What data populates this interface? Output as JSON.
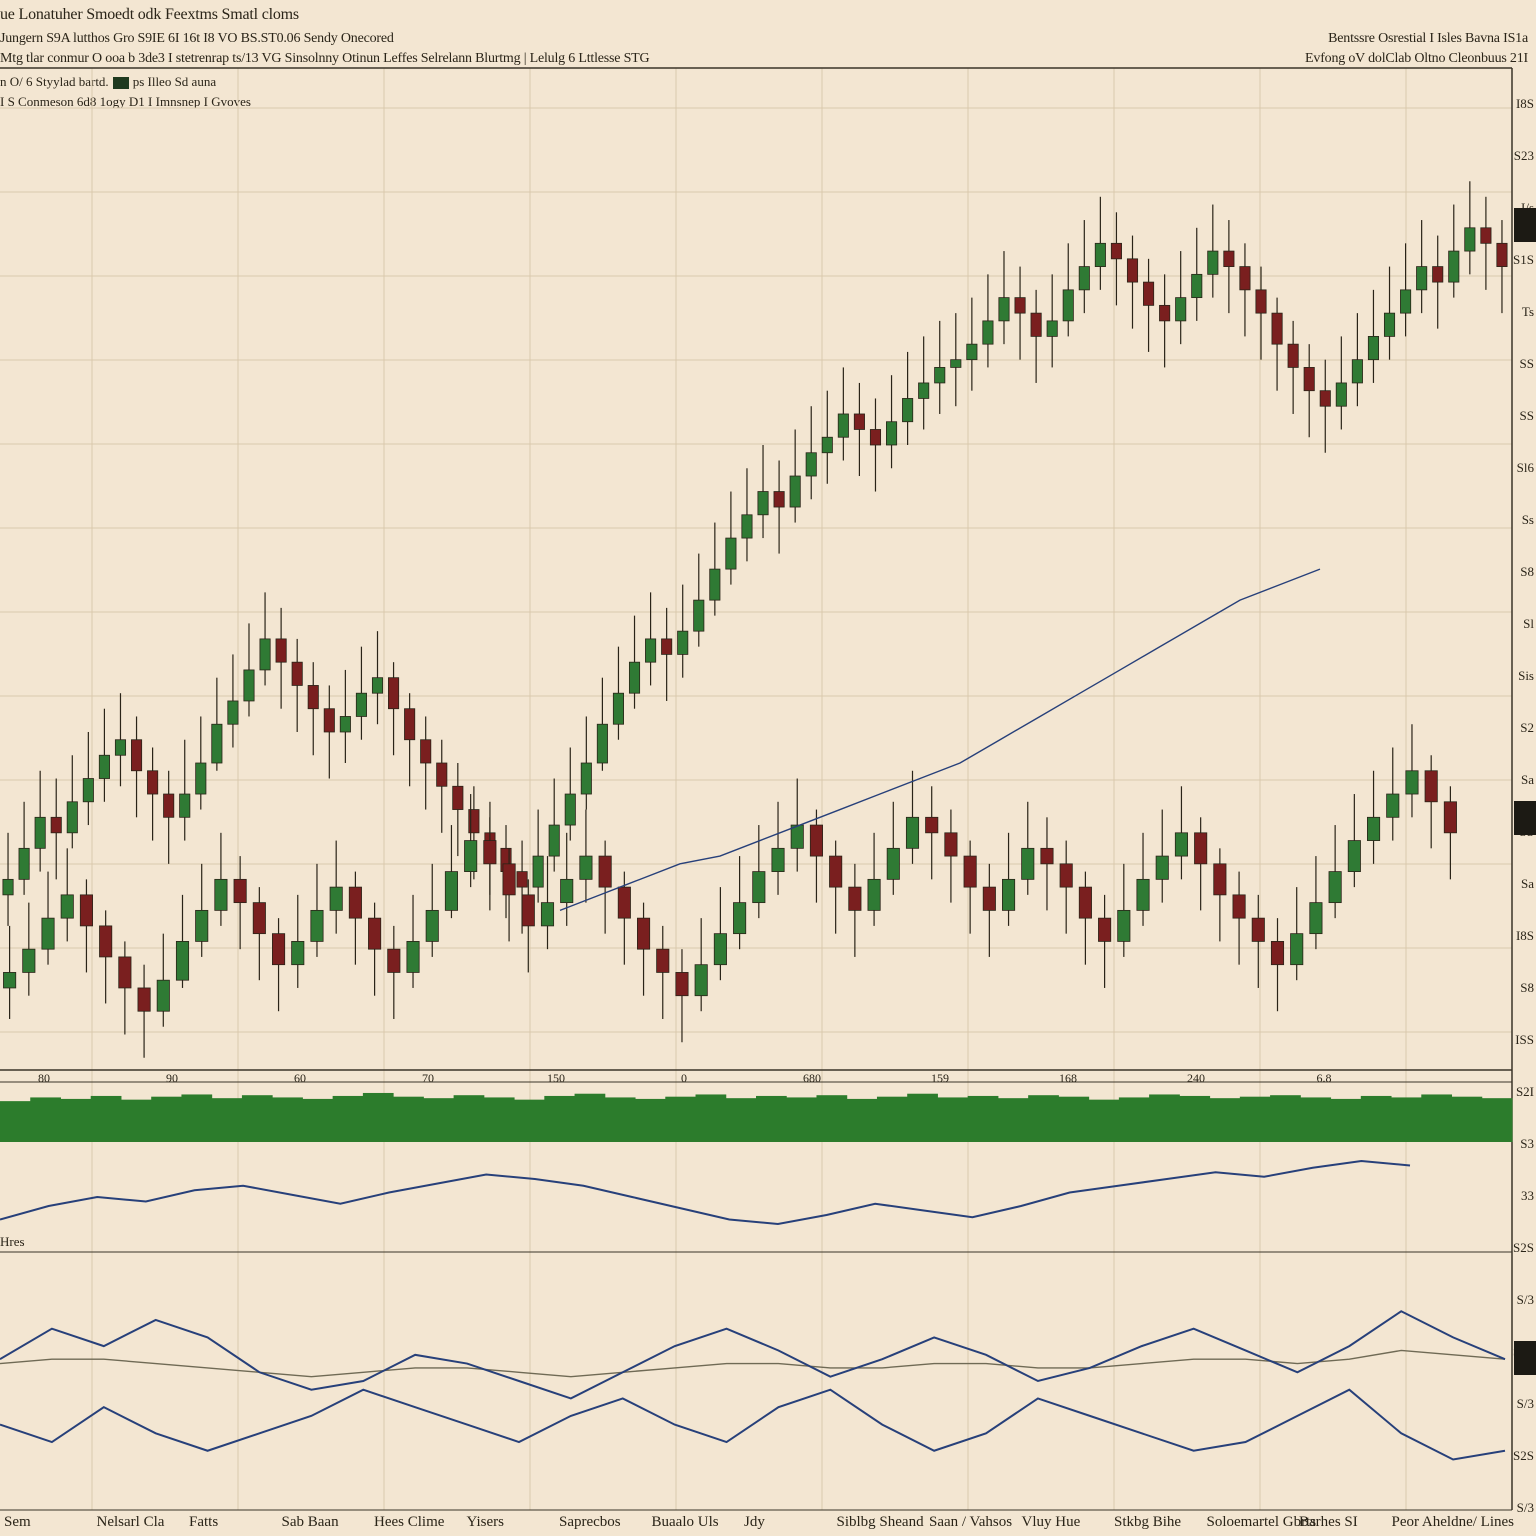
{
  "header": {
    "title": "ue Lonatuher Smoedt odk Feextms Smatl cloms",
    "line1": "Jungern S9A lutthos Gro S9IE 6I 16t I8 VO  BS.ST0.06 Sendy Onecored",
    "line2": "Mtg tlar conmur  O ooa b 3de3 I stetrenrap ts/13 VG Sinsolnny Otinun  Leffes Selrelann  Blurtmg  |  Lelulg 6 Lttlesse STG",
    "right1": "Bentssre Osrestial I  Isles  Bavna IS1a",
    "right2": "Evfong oV dolClab Oltno Cleonbuus 21I"
  },
  "legend": {
    "row1_prefix": "n  O/ 6  Styylad bartd.",
    "row1_suffix": "ps Illeo Sd auna",
    "row2": "I S  Conmeson 6d8 1ogy D1 I Imnsnep I Gvoves"
  },
  "indicator_label": "Hres",
  "bottom_labels": [
    "Sem",
    "Nelsarl Cla",
    "Fatts",
    "Sab Baan",
    "Hees Clime",
    "Yisers",
    "Saprecbos",
    "Buaalo Uls",
    "Jdy",
    "Siblbg Sheand",
    "Saan / Vahsos",
    "Vluy Hue",
    "Stkbg Bihe",
    "Soloemartel Gbrts",
    "Barhes  SI",
    "Peor  Aheldne/ Lines"
  ],
  "x_ticks": [
    "80",
    "90",
    "60",
    "70",
    "150",
    "0",
    "680",
    "159",
    "168",
    "240",
    "6.8"
  ],
  "y_ticks": [
    "I8S",
    "S23",
    "I/s",
    "S1S",
    "Ts",
    "SS",
    "SS",
    "Sl6",
    "Ss",
    "S8",
    "Sl",
    "Sis",
    "S2",
    "Sa",
    "SS",
    "Sa",
    "I8S",
    "S8",
    "ISS",
    "S2I",
    "S3",
    "33",
    "S2S",
    "S/3",
    "S2S",
    "S/3",
    "S2S",
    "S/3"
  ],
  "colors": {
    "bg": "#f3e6d2",
    "grid": "#d9c9ad",
    "bull": "#2f7a34",
    "bear": "#7a1f1f",
    "wick": "#2a2418",
    "volume": "#2c7c2c",
    "indicator_line": "#27407a",
    "signal_line": "#6f6a55",
    "frame": "#3a3428"
  },
  "chart_data": [
    {
      "type": "candlestick",
      "title": "ue Lonatuher Smoedt odk Feextms Smatl cloms",
      "series": [
        {
          "name": "upper",
          "close": [
            52,
            56,
            60,
            58,
            62,
            65,
            68,
            70,
            66,
            63,
            60,
            63,
            67,
            72,
            75,
            79,
            83,
            80,
            77,
            74,
            71,
            73,
            76,
            78,
            74,
            70,
            67,
            64,
            61,
            58,
            56,
            53,
            51,
            55,
            59,
            63,
            67,
            72,
            76,
            80,
            83,
            81,
            84,
            88,
            92,
            96,
            99,
            102,
            100,
            104,
            107,
            109,
            112,
            110,
            108,
            111,
            114,
            116,
            118,
            119,
            121,
            124,
            127,
            125,
            122,
            124,
            128,
            131,
            134,
            132,
            129,
            126,
            124,
            127,
            130,
            133,
            131,
            128,
            125,
            121,
            118,
            115,
            113,
            116,
            119,
            122,
            125,
            128,
            131,
            129,
            133,
            136,
            134,
            131
          ],
          "high": [
            55,
            59,
            63,
            62,
            65,
            68,
            71,
            73,
            70,
            66,
            63,
            67,
            70,
            75,
            78,
            82,
            86,
            84,
            80,
            77,
            74,
            76,
            79,
            81,
            77,
            73,
            70,
            67,
            64,
            61,
            59,
            56,
            54,
            58,
            62,
            66,
            70,
            75,
            79,
            83,
            86,
            84,
            87,
            91,
            95,
            99,
            102,
            105,
            103,
            107,
            110,
            112,
            115,
            113,
            111,
            114,
            117,
            119,
            121,
            122,
            124,
            127,
            130,
            128,
            125,
            127,
            131,
            134,
            137,
            135,
            132,
            129,
            127,
            130,
            133,
            136,
            134,
            131,
            128,
            124,
            121,
            118,
            116,
            119,
            122,
            125,
            128,
            131,
            134,
            132,
            136,
            139,
            137,
            134
          ],
          "low": [
            49,
            53,
            56,
            55,
            59,
            62,
            65,
            67,
            63,
            60,
            57,
            60,
            64,
            69,
            72,
            76,
            80,
            77,
            74,
            71,
            68,
            70,
            73,
            75,
            71,
            67,
            64,
            61,
            58,
            55,
            53,
            50,
            48,
            52,
            56,
            60,
            64,
            69,
            73,
            77,
            80,
            78,
            81,
            85,
            89,
            93,
            96,
            99,
            97,
            101,
            104,
            106,
            109,
            107,
            105,
            108,
            111,
            113,
            115,
            116,
            118,
            121,
            124,
            122,
            119,
            121,
            125,
            128,
            131,
            129,
            126,
            123,
            121,
            124,
            127,
            130,
            128,
            125,
            122,
            118,
            115,
            112,
            110,
            113,
            116,
            119,
            122,
            125,
            128,
            126,
            130,
            133,
            131,
            128
          ]
        },
        {
          "name": "lower",
          "close": [
            40,
            43,
            47,
            50,
            46,
            42,
            38,
            35,
            39,
            44,
            48,
            52,
            49,
            45,
            41,
            44,
            48,
            51,
            47,
            43,
            40,
            44,
            48,
            53,
            57,
            54,
            50,
            46,
            49,
            52,
            55,
            51,
            47,
            43,
            40,
            37,
            41,
            45,
            49,
            53,
            56,
            59,
            55,
            51,
            48,
            52,
            56,
            60,
            58,
            55,
            51,
            48,
            52,
            56,
            54,
            51,
            47,
            44,
            48,
            52,
            55,
            58,
            54,
            50,
            47,
            44,
            41,
            45,
            49,
            53,
            57,
            60,
            63,
            66,
            62,
            58
          ],
          "high": [
            43,
            46,
            50,
            53,
            49,
            45,
            41,
            38,
            42,
            47,
            51,
            55,
            52,
            48,
            44,
            47,
            51,
            54,
            50,
            46,
            43,
            47,
            51,
            56,
            60,
            57,
            53,
            49,
            52,
            55,
            58,
            54,
            50,
            46,
            43,
            40,
            44,
            48,
            52,
            56,
            59,
            62,
            58,
            54,
            51,
            55,
            59,
            63,
            61,
            58,
            54,
            51,
            55,
            59,
            57,
            54,
            50,
            47,
            51,
            55,
            58,
            61,
            57,
            53,
            50,
            47,
            44,
            48,
            52,
            56,
            60,
            63,
            66,
            69,
            65,
            61
          ],
          "low": [
            37,
            40,
            44,
            47,
            43,
            39,
            35,
            32,
            36,
            41,
            45,
            49,
            46,
            42,
            38,
            41,
            45,
            48,
            44,
            40,
            37,
            41,
            45,
            50,
            54,
            51,
            47,
            43,
            46,
            49,
            52,
            48,
            44,
            40,
            37,
            34,
            38,
            42,
            46,
            50,
            53,
            56,
            52,
            48,
            45,
            49,
            53,
            57,
            55,
            52,
            48,
            45,
            49,
            53,
            51,
            48,
            44,
            41,
            45,
            49,
            52,
            55,
            51,
            47,
            44,
            41,
            38,
            42,
            46,
            50,
            54,
            57,
            60,
            63,
            59,
            55
          ]
        },
        {
          "name": "moving average",
          "values": [
            48,
            50,
            52,
            54,
            55,
            57,
            59,
            61,
            63,
            65,
            67,
            70,
            73,
            76,
            79,
            82,
            85,
            88,
            90,
            92
          ]
        }
      ],
      "volume": [
        55,
        60,
        58,
        62,
        57,
        61,
        64,
        59,
        63,
        60,
        58,
        62,
        66,
        61,
        59,
        63,
        60,
        57,
        62,
        65,
        60,
        58,
        61,
        64,
        59,
        62,
        60,
        63,
        58,
        61,
        65,
        60,
        62,
        59,
        63,
        61,
        57,
        60,
        64,
        62,
        59,
        61,
        63,
        60,
        58,
        62,
        60,
        64,
        61,
        59
      ],
      "indicator_1": [
        40,
        46,
        50,
        48,
        53,
        55,
        51,
        47,
        52,
        56,
        60,
        58,
        55,
        50,
        45,
        40,
        38,
        42,
        47,
        44,
        41,
        46,
        52,
        55,
        58,
        61,
        59,
        63,
        66,
        64
      ],
      "indicator_2": {
        "line_a": [
          55,
          62,
          58,
          64,
          60,
          52,
          48,
          50,
          56,
          54,
          50,
          46,
          52,
          58,
          62,
          57,
          51,
          55,
          60,
          56,
          50,
          53,
          58,
          62,
          57,
          52,
          58,
          66,
          60,
          55
        ],
        "line_b": [
          54,
          55,
          55,
          54,
          53,
          52,
          51,
          52,
          53,
          53,
          52,
          51,
          52,
          53,
          54,
          54,
          53,
          53,
          54,
          54,
          53,
          53,
          54,
          55,
          55,
          54,
          55,
          57,
          56,
          55
        ],
        "line_c": [
          40,
          36,
          44,
          38,
          34,
          38,
          42,
          48,
          44,
          40,
          36,
          42,
          46,
          40,
          36,
          44,
          48,
          40,
          34,
          38,
          46,
          42,
          38,
          34,
          36,
          42,
          48,
          38,
          32,
          34
        ]
      }
    }
  ]
}
